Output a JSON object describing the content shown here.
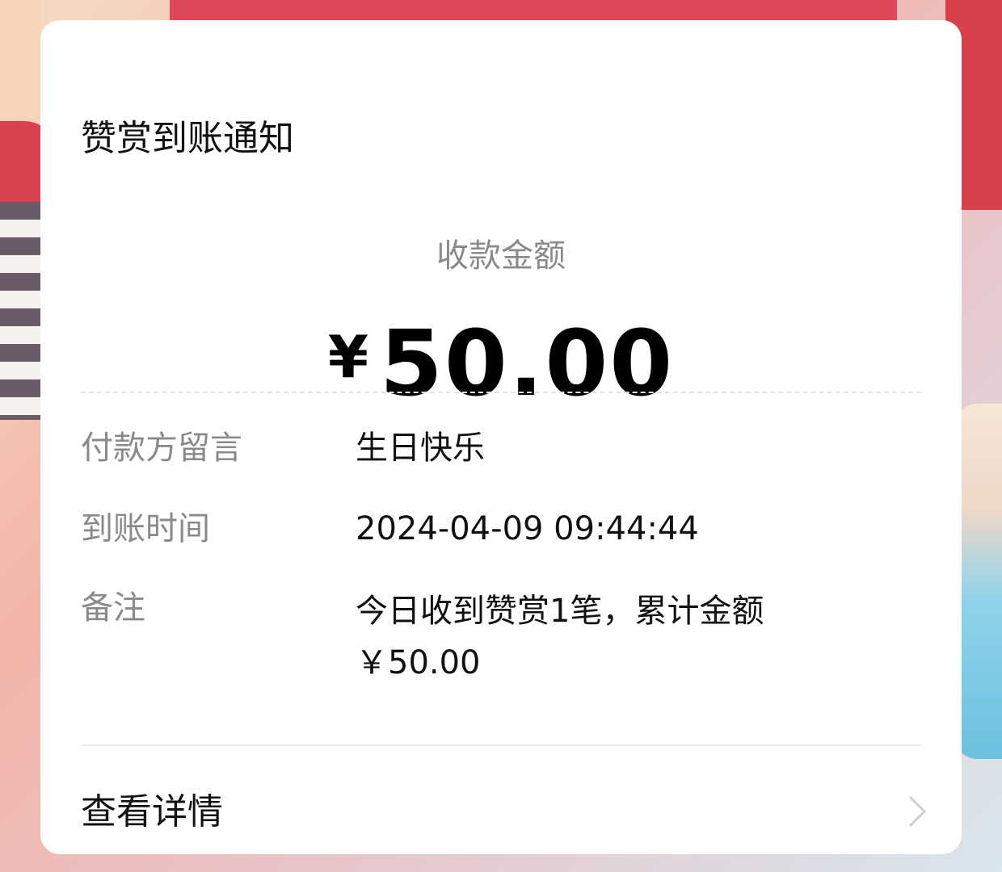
{
  "card": {
    "title": "赞赏到账通知",
    "amount_label": "收款金额",
    "currency_symbol": "¥",
    "amount": "50.00",
    "rows": [
      {
        "label": "付款方留言",
        "value": "生日快乐"
      },
      {
        "label": "到账时间",
        "value": "2024-04-09 09:44:44"
      },
      {
        "label": "备注",
        "value_line1": "今日收到赞赏1笔，累计金额",
        "value_line2": "￥50.00"
      }
    ],
    "details_label": "查看详情",
    "details_icon": "chevron-right-icon"
  },
  "colors": {
    "card_background": "#ffffff",
    "primary_text": "#111111",
    "secondary_text": "#8a8a8a",
    "divider": "#eeeeee"
  }
}
